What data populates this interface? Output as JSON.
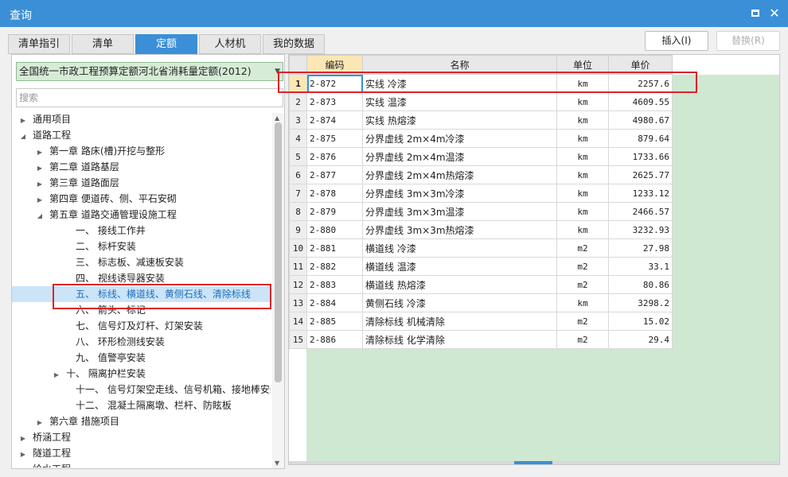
{
  "window": {
    "title": "查询"
  },
  "tabs": [
    "清单指引",
    "清单",
    "定额",
    "人材机",
    "我的数据"
  ],
  "toolbar": {
    "insert_label": "插入(I)",
    "replace_label": "替换(R)"
  },
  "left": {
    "combo_value": "全国统一市政工程预算定额河北省消耗量定额(2012)",
    "search_placeholder": "搜索",
    "tree": [
      {
        "label": "通用项目",
        "toggle": "right"
      },
      {
        "label": "道路工程",
        "toggle": "down"
      },
      {
        "label": "第一章 路床(槽)开挖与整形",
        "toggle": "right"
      },
      {
        "label": "第二章 道路基层",
        "toggle": "right"
      },
      {
        "label": "第三章 道路面层",
        "toggle": "right"
      },
      {
        "label": "第四章 便道砖、侧、平石安砌",
        "toggle": "right"
      },
      {
        "label": "第五章 道路交通管理设施工程",
        "toggle": "down"
      },
      {
        "label": "一、 接线工作井",
        "toggle": ""
      },
      {
        "label": "二、 标杆安装",
        "toggle": ""
      },
      {
        "label": "三、 标志板、减速板安装",
        "toggle": ""
      },
      {
        "label": "四、 视线诱导器安装",
        "toggle": ""
      },
      {
        "label": "五、 标线、横道线、黄侧石线、清除标线",
        "toggle": ""
      },
      {
        "label": "六、 箭头、标记",
        "toggle": ""
      },
      {
        "label": "七、 信号灯及灯杆、灯架安装",
        "toggle": ""
      },
      {
        "label": "八、 环形检测线安装",
        "toggle": ""
      },
      {
        "label": "九、 值警亭安装",
        "toggle": ""
      },
      {
        "label": "十、 隔离护栏安装",
        "toggle": "right"
      },
      {
        "label": "十一、 信号灯架空走线、信号机箱、接地棒安装",
        "toggle": ""
      },
      {
        "label": "十二、 混凝土隔离墩、栏杆、防眩板",
        "toggle": ""
      },
      {
        "label": "第六章 措施项目",
        "toggle": "right"
      },
      {
        "label": "桥涵工程",
        "toggle": "right"
      },
      {
        "label": "隧道工程",
        "toggle": "right"
      },
      {
        "label": "给水工程",
        "toggle": "right"
      }
    ]
  },
  "grid": {
    "columns": [
      "编码",
      "名称",
      "单位",
      "单价"
    ],
    "rows": [
      {
        "no": "1",
        "code": "2-872",
        "name": "实线 冷漆",
        "unit": "km",
        "price": "2257.6"
      },
      {
        "no": "2",
        "code": "2-873",
        "name": "实线 温漆",
        "unit": "km",
        "price": "4609.55"
      },
      {
        "no": "3",
        "code": "2-874",
        "name": "实线 热熔漆",
        "unit": "km",
        "price": "4980.67"
      },
      {
        "no": "4",
        "code": "2-875",
        "name": "分界虚线 2m×4m冷漆",
        "unit": "km",
        "price": "879.64"
      },
      {
        "no": "5",
        "code": "2-876",
        "name": "分界虚线 2m×4m温漆",
        "unit": "km",
        "price": "1733.66"
      },
      {
        "no": "6",
        "code": "2-877",
        "name": "分界虚线 2m×4m热熔漆",
        "unit": "km",
        "price": "2625.77"
      },
      {
        "no": "7",
        "code": "2-878",
        "name": "分界虚线 3m×3m冷漆",
        "unit": "km",
        "price": "1233.12"
      },
      {
        "no": "8",
        "code": "2-879",
        "name": "分界虚线 3m×3m温漆",
        "unit": "km",
        "price": "2466.57"
      },
      {
        "no": "9",
        "code": "2-880",
        "name": "分界虚线 3m×3m热熔漆",
        "unit": "km",
        "price": "3232.93"
      },
      {
        "no": "10",
        "code": "2-881",
        "name": "横道线 冷漆",
        "unit": "m2",
        "price": "27.98"
      },
      {
        "no": "11",
        "code": "2-882",
        "name": "横道线 温漆",
        "unit": "m2",
        "price": "33.1"
      },
      {
        "no": "12",
        "code": "2-883",
        "name": "横道线 热熔漆",
        "unit": "m2",
        "price": "80.86"
      },
      {
        "no": "13",
        "code": "2-884",
        "name": "黄侧石线 冷漆",
        "unit": "km",
        "price": "3298.2"
      },
      {
        "no": "14",
        "code": "2-885",
        "name": "清除标线 机械清除",
        "unit": "m2",
        "price": "15.02"
      },
      {
        "no": "15",
        "code": "2-886",
        "name": "清除标线 化学清除",
        "unit": "m2",
        "price": "29.4"
      }
    ]
  },
  "colors": {
    "accent": "#3b8fd6",
    "highlight": "#e0202a",
    "grid_bg": "#cfe8d1"
  }
}
